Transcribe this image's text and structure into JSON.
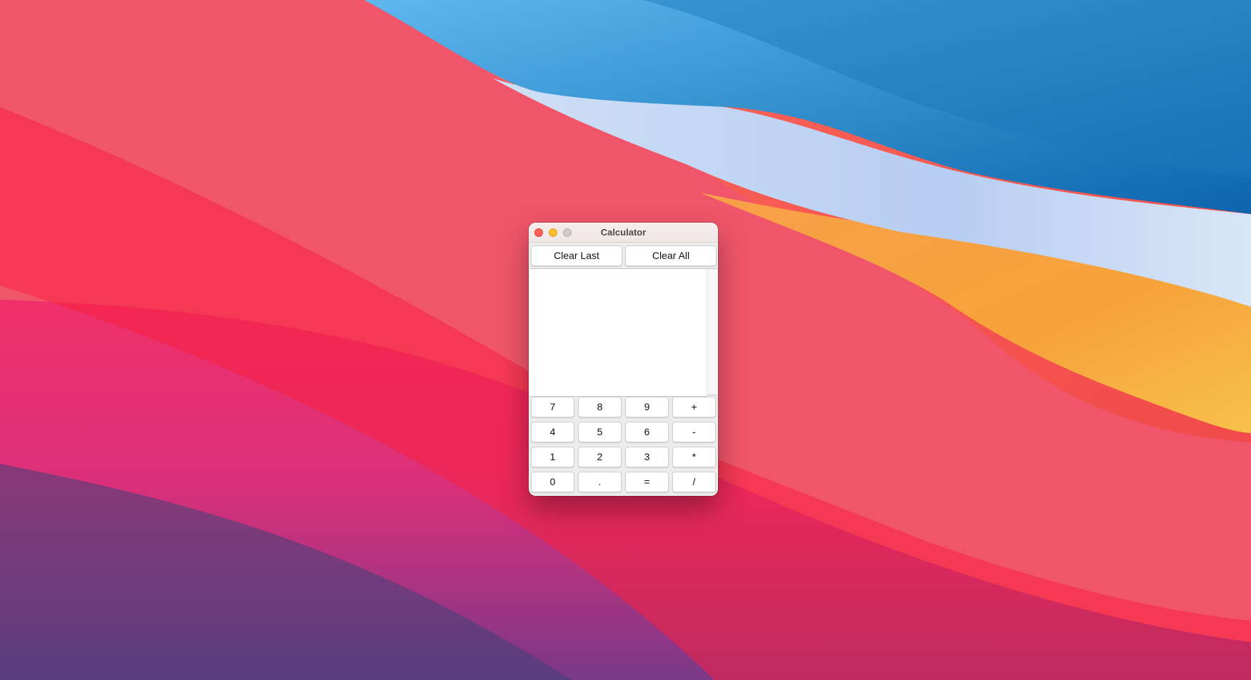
{
  "window": {
    "title": "Calculator",
    "traffic_lights": {
      "close": "close-button",
      "minimize": "minimize-button",
      "zoom": "zoom-button"
    }
  },
  "toolbar": {
    "clear_last_label": "Clear Last",
    "clear_all_label": "Clear All"
  },
  "display": {
    "value": ""
  },
  "keypad": {
    "rows": [
      [
        "7",
        "8",
        "9",
        "+"
      ],
      [
        "4",
        "5",
        "6",
        "-"
      ],
      [
        "1",
        "2",
        "3",
        "*"
      ],
      [
        "0",
        ".",
        "=",
        "/"
      ]
    ]
  },
  "colors": {
    "close": "#fe5f57",
    "minimize": "#febc2e",
    "zoom": "#cfcaca",
    "window_bg": "#ececec",
    "button_bg": "#ffffff"
  }
}
